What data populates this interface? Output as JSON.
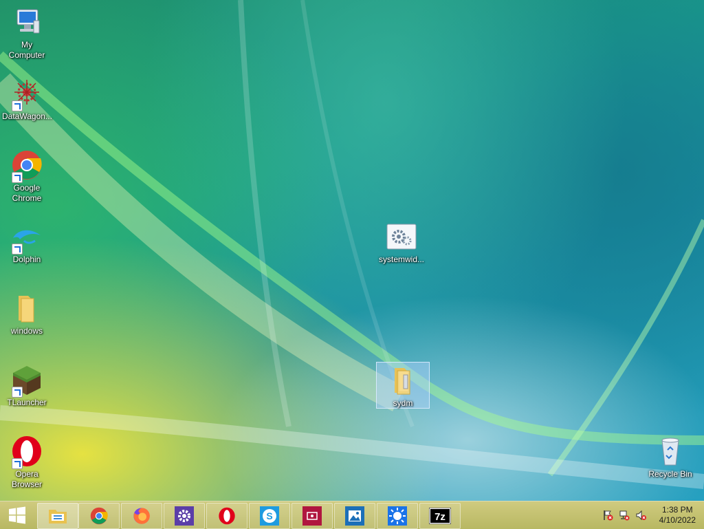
{
  "desktop": {
    "icons": [
      {
        "label": "My Computer"
      },
      {
        "label": "DataWagon..."
      },
      {
        "label": "Google\nChrome"
      },
      {
        "label": "Dolphin"
      },
      {
        "label": "windows"
      },
      {
        "label": "TLauncher"
      },
      {
        "label": "Opera\nBrowser"
      },
      {
        "label": "systemwid..."
      },
      {
        "label": "sydm"
      },
      {
        "label": "Recycle Bin"
      }
    ]
  },
  "taskbar": {
    "pinned": [
      {
        "icon": "file-explorer-icon"
      },
      {
        "icon": "chrome-icon"
      },
      {
        "icon": "firefox-icon"
      },
      {
        "icon": "settings-gear-icon"
      },
      {
        "icon": "opera-icon"
      },
      {
        "icon": "skype-icon"
      },
      {
        "icon": "media-app-icon"
      },
      {
        "icon": "photos-icon"
      },
      {
        "icon": "brightness-icon"
      },
      {
        "icon": "7zip-icon"
      }
    ],
    "clock": {
      "time": "1:38 PM",
      "date": "4/10/2022"
    }
  },
  "colors": {
    "taskbar": "#c8c478",
    "selection": "#b4d2ff",
    "accent": "#1e6fd9"
  }
}
